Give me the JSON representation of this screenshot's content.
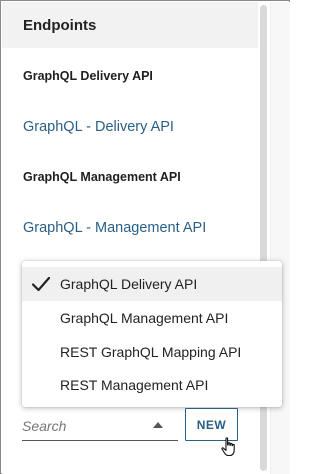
{
  "panel": {
    "title": "Endpoints",
    "sections": [
      {
        "label": "GraphQL Delivery API",
        "link": "GraphQL - Delivery API"
      },
      {
        "label": "GraphQL Management API",
        "link": "GraphQL - Management API"
      }
    ]
  },
  "dropdown": {
    "options": [
      {
        "label": "GraphQL Delivery API",
        "selected": true
      },
      {
        "label": "GraphQL Management API",
        "selected": false
      },
      {
        "label": "REST GraphQL Mapping API",
        "selected": false
      },
      {
        "label": "REST Management API",
        "selected": false
      }
    ]
  },
  "search": {
    "placeholder": "Search",
    "value": ""
  },
  "new_button": {
    "label": "NEW"
  },
  "icons": {
    "check": "checkmark-icon",
    "caret": "caret-up-icon",
    "cursor": "hand-pointer-cursor-icon"
  },
  "colors": {
    "link": "#2a5f86",
    "header_bg": "#f2f2f2",
    "selected_bg": "#f0f0f0"
  }
}
